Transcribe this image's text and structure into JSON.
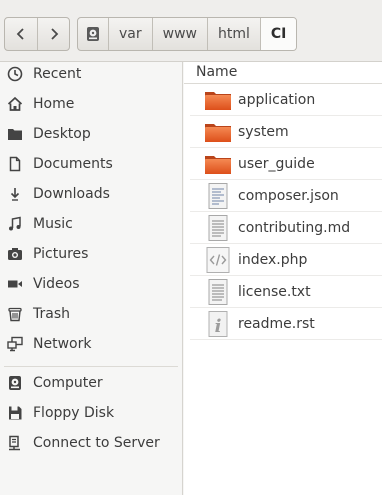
{
  "toolbar": {
    "breadcrumbs": [
      "var",
      "www",
      "html",
      "CI"
    ]
  },
  "sidebar": {
    "places": [
      "Recent",
      "Home",
      "Desktop",
      "Documents",
      "Downloads",
      "Music",
      "Pictures",
      "Videos",
      "Trash",
      "Network"
    ],
    "devices": [
      "Computer",
      "Floppy Disk",
      "Connect to Server"
    ]
  },
  "main": {
    "column_name": "Name",
    "files": [
      {
        "name": "application",
        "type": "folder"
      },
      {
        "name": "system",
        "type": "folder"
      },
      {
        "name": "user_guide",
        "type": "folder"
      },
      {
        "name": "composer.json",
        "type": "text"
      },
      {
        "name": "contributing.md",
        "type": "text"
      },
      {
        "name": "index.php",
        "type": "code"
      },
      {
        "name": "license.txt",
        "type": "text"
      },
      {
        "name": "readme.rst",
        "type": "info"
      }
    ]
  },
  "colors": {
    "folder": "#ef6c35",
    "toolbar_bg": "#efeeec",
    "sidebar_bg": "#f6f6f5"
  }
}
